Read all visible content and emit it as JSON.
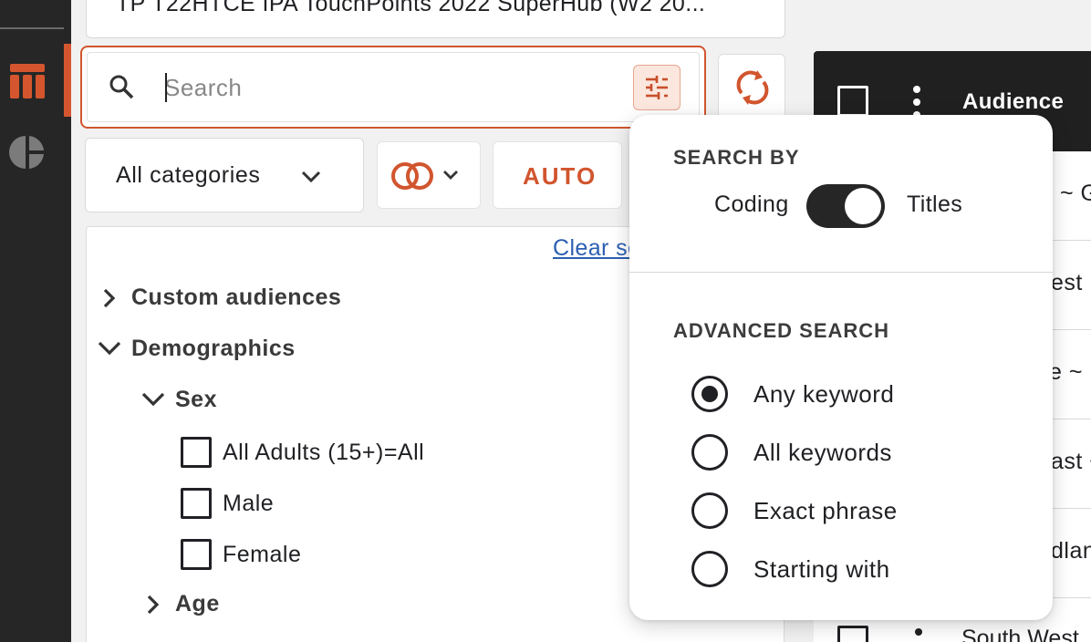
{
  "dataset": {
    "label": "TP T22HTCE IPA TouchPoints 2022 SuperHub (W2 20..."
  },
  "search": {
    "placeholder": "Search",
    "value": ""
  },
  "filters": {
    "category": "All categories",
    "auto_label": "AUTO"
  },
  "tree": {
    "clear_link": "Clear selection",
    "nodes": {
      "custom_audiences": "Custom audiences",
      "demographics": "Demographics",
      "sex": "Sex",
      "all_adults": "All Adults (15+)=All",
      "male": "Male",
      "female": "Female",
      "age": "Age"
    }
  },
  "audience_panel": {
    "header_title": "Audience",
    "rows": [
      {
        "text": "~ Ge"
      },
      {
        "text": "est"
      },
      {
        "text": "e ~"
      },
      {
        "text": "ast ~"
      },
      {
        "text": "dlan"
      },
      {
        "text": "South West"
      }
    ]
  },
  "search_options": {
    "search_by_title": "SEARCH BY",
    "toggle_left": "Coding",
    "toggle_right": "Titles",
    "toggle_state": "Titles",
    "advanced_title": "ADVANCED SEARCH",
    "options": [
      {
        "label": "Any keyword",
        "selected": true
      },
      {
        "label": "All keywords",
        "selected": false
      },
      {
        "label": "Exact phrase",
        "selected": false
      },
      {
        "label": "Starting with",
        "selected": false
      }
    ]
  },
  "colors": {
    "accent": "#d1552e",
    "dark": "#262626",
    "link": "#2b5fb1"
  },
  "icons": [
    "grid-icon",
    "pie-chart-icon",
    "search-icon",
    "filter-sliders-icon",
    "refresh-icon",
    "chevron-down-icon",
    "venn-icon",
    "chevron-right-icon",
    "more-vert-icon"
  ]
}
